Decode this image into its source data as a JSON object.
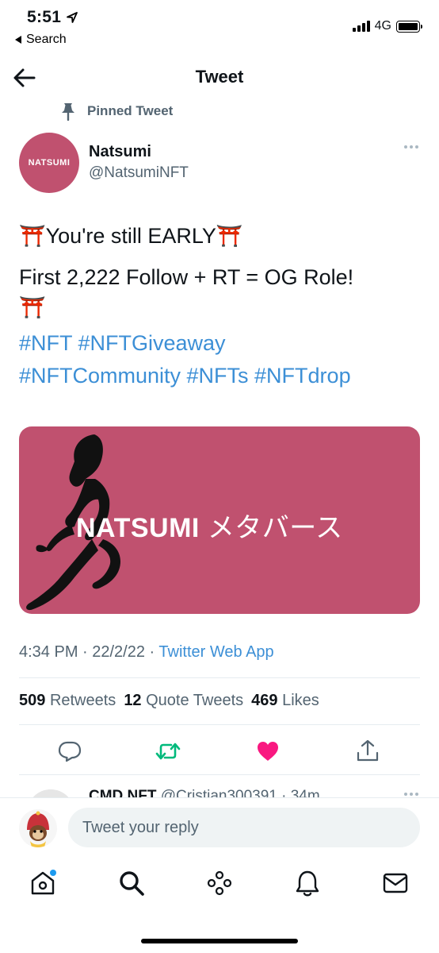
{
  "status_bar": {
    "time": "5:51",
    "back_label": "Search",
    "network": "4G"
  },
  "header": {
    "title": "Tweet"
  },
  "pinned_label": "Pinned Tweet",
  "author": {
    "avatar_text": "NATSUMI",
    "name": "Natsumi",
    "handle": "@NatsumiNFT"
  },
  "tweet": {
    "line1": "You're still EARLY",
    "line2": "First 2,222 Follow + RT = OG Role!",
    "torii": "⛩️",
    "hashtags_line1": "#NFT #NFTGiveaway",
    "hashtags_line2": "#NFTCommunity #NFTs #NFTdrop",
    "media_title_bold": "NATSUMI",
    "media_title_jp": "メタバース",
    "time": "4:34 PM · 22/2/22 · ",
    "source": "Twitter Web App"
  },
  "stats": {
    "retweets_count": "509",
    "retweets_label": "Retweets",
    "quotes_count": "12",
    "quotes_label": "Quote Tweets",
    "likes_count": "469",
    "likes_label": "Likes"
  },
  "reply_peek": {
    "name": "CMD NFT",
    "handle_time": "@Cristian300391 · 34m"
  },
  "reply": {
    "placeholder": "Tweet your reply"
  },
  "colors": {
    "accent": "#1d9bf0",
    "link": "#3c8fd6",
    "retweet": "#00ba7c",
    "like": "#f91880",
    "media_bg": "#c0516f",
    "secondary_text": "#536471"
  },
  "icons": [
    "location-arrow-icon",
    "back-arrow-icon",
    "pin-icon",
    "more-icon",
    "reply-icon",
    "retweet-icon",
    "like-icon",
    "share-icon",
    "home-icon",
    "search-icon",
    "spaces-icon",
    "notifications-icon",
    "messages-icon"
  ]
}
